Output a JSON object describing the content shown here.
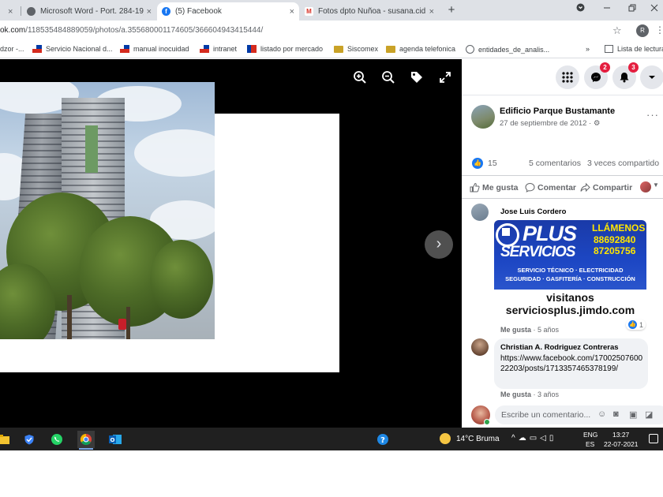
{
  "browser": {
    "tabs": [
      {
        "title": "",
        "close": "×"
      },
      {
        "title": "Microsoft Word - Port. 284-19_P",
        "close": "×"
      },
      {
        "title": "(5) Facebook",
        "close": "×"
      },
      {
        "title": "Fotos dpto Ñuñoa - susana.cid.e",
        "close": "×"
      }
    ],
    "new_tab": "+",
    "url_prefix": "ok.com",
    "url_path": "/118535484889059/photos/a.355680001174605/366604943415444/",
    "bookmarks": [
      "dzor -...",
      "Servicio Nacional d...",
      "manual inocuidad",
      "intranet",
      "listado por mercado",
      "Siscomex",
      "agenda telefonica",
      "entidades_de_analis...",
      "»",
      "Lista de lectura"
    ],
    "profile_initial": "R"
  },
  "viewer": {
    "next": "›"
  },
  "facebook": {
    "messenger_badge": "2",
    "notifications_badge": "3",
    "post": {
      "author": "Edificio Parque Bustamante",
      "date": "27 de septiembre de 2012 ·",
      "privacy": "⚙",
      "likes": "15",
      "comments": "5 comentarios",
      "shares": "3 veces compartido"
    },
    "actions": {
      "like": "Me gusta",
      "comment": "Comentar",
      "share": "Compartir"
    },
    "comments": [
      {
        "name": "Jose Luis Cordero",
        "meta_like": "Me gusta",
        "meta_time": " · 5 años",
        "likes": "1",
        "ad": {
          "brand_top": "PLUS",
          "brand_bottom": "SERVICIOS",
          "call": "LLÁMENOS",
          "phone1": "88692840",
          "phone2": "87205756",
          "line1": "SERVICIO TÉCNICO · ELECTRICIDAD",
          "line2": "SEGURIDAD · GASFITERÍA · CONSTRUCCIÓN",
          "visit": "visitanos",
          "site": "serviciosplus.jimdo.com"
        }
      },
      {
        "name": "Christian A. Rodriguez Contreras",
        "text": "https://www.facebook.com/1700250760022203/posts/1713357465378199/",
        "meta_like": "Me gusta",
        "meta_time": " · 3 años"
      }
    ],
    "composer_placeholder": "Escribe un comentario..."
  },
  "taskbar": {
    "temperature": "14°C",
    "weather": "Bruma",
    "lang1": "ENG",
    "lang2": "ES",
    "time": "13:27",
    "date": "22-07-2021"
  }
}
